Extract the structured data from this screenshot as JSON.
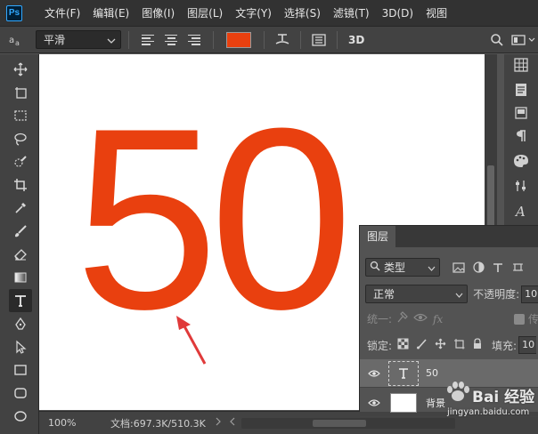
{
  "app": {
    "logo": "Ps"
  },
  "menu": [
    "文件(F)",
    "编辑(E)",
    "图像(I)",
    "图层(L)",
    "文字(Y)",
    "选择(S)",
    "滤镜(T)",
    "3D(D)",
    "视图"
  ],
  "options": {
    "tool_preset_icon": "text-tool-preset-icon",
    "font_style": "平滑",
    "text_color": "#e9400f",
    "threed_label": "3D"
  },
  "tools": [
    "move",
    "artboard",
    "marquee",
    "lasso",
    "quick-select",
    "crop",
    "eyedropper",
    "brush",
    "eraser",
    "gradient",
    "text",
    "pen",
    "path-select",
    "rectangle",
    "rounded-rect",
    "ellipse"
  ],
  "canvas": {
    "text": "50",
    "text_color": "#e9400f"
  },
  "status": {
    "zoom": "100%",
    "doc_size": "文档:697.3K/510.3K"
  },
  "layers_panel": {
    "tab": "图层",
    "filter_kind": "类型",
    "blend_mode": "正常",
    "opacity_label": "不透明度:",
    "opacity_value": "10",
    "unify_label": "统一:",
    "propagate_label": "传",
    "lock_label": "锁定:",
    "fill_label": "填充:",
    "fill_value": "10",
    "layers": [
      {
        "name": "50",
        "kind": "text",
        "selected": true
      },
      {
        "name": "背景",
        "kind": "background",
        "selected": false
      }
    ]
  },
  "watermark": {
    "text": "Bai 经验",
    "url": "jingyan.baidu.com"
  }
}
